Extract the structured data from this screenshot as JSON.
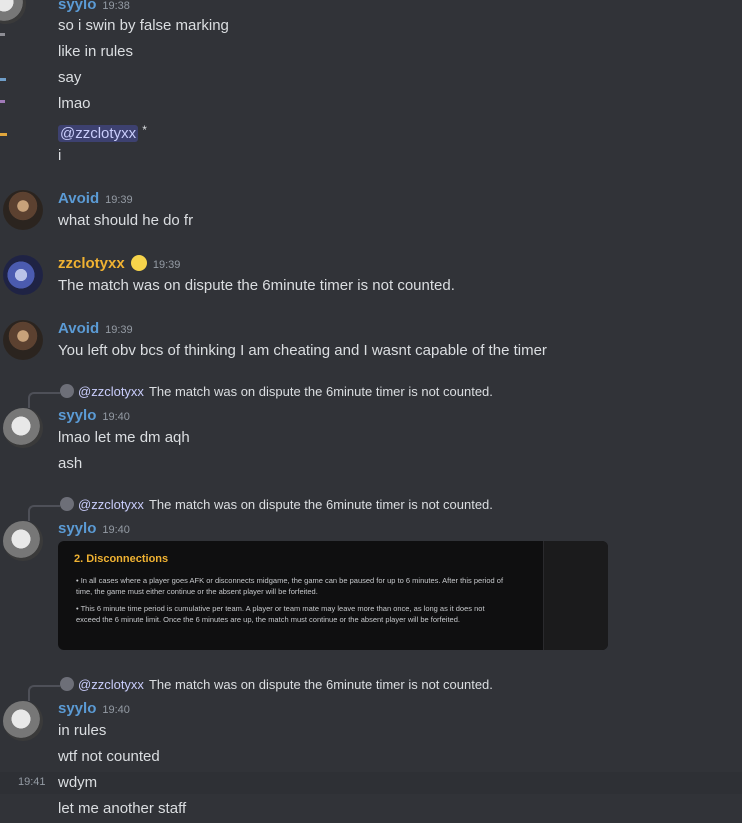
{
  "colors": {
    "background": "#313338",
    "username_blue": "#5b9bd5",
    "username_yellow": "#f0b232",
    "mention_bg": "#3c4270",
    "embed_bg": "#0f0f10",
    "embed_title": "#f0b232"
  },
  "messages": [
    {
      "username": "syylo",
      "time": "19:38",
      "lines": [
        "so i swin by false marking",
        "like in rules",
        "say",
        "lmao"
      ],
      "mention": "@zzclotyxx",
      "mention_suffix": "*",
      "last_line": "i"
    },
    {
      "username": "Avoid",
      "time": "19:39",
      "lines": [
        "what should he do fr"
      ]
    },
    {
      "username": "zzclotyxx",
      "badge_icon": "emoji-badge-icon",
      "time": "19:39",
      "lines": [
        "The match was on dispute the 6minute timer is not counted."
      ]
    },
    {
      "username": "Avoid",
      "time": "19:39",
      "lines": [
        "You left obv bcs of thinking I am cheating and I wasnt capable of the timer"
      ]
    },
    {
      "reply": {
        "who": "@zzclotyxx",
        "text": "The match was on dispute the 6minute timer is not counted."
      },
      "username": "syylo",
      "time": "19:40",
      "lines": [
        "lmao let me dm aqh",
        "ash"
      ]
    },
    {
      "reply": {
        "who": "@zzclotyxx",
        "text": "The match was on dispute the 6minute timer is not counted."
      },
      "username": "syylo",
      "time": "19:40",
      "embed": {
        "title": "2. Disconnections",
        "bullets": [
          "In all cases where a player goes AFK or disconnects midgame, the game can be paused for up to 6 minutes. After this period of time, the game must either continue or the absent player will be forfeited.",
          "This 6 minute time period is cumulative per team. A player or team mate may leave more than once, as long as it does not exceed the 6 minute limit. Once the 6 minutes are up, the match must continue or the absent player will be forfeited."
        ]
      }
    },
    {
      "reply": {
        "who": "@zzclotyxx",
        "text": "The match was on dispute the 6minute timer is not counted."
      },
      "username": "syylo",
      "time": "19:40",
      "lines": [
        "in rules",
        "wtf not counted"
      ],
      "hover_time": "19:41",
      "hover_line": "wdym",
      "after_line": "let me another staff"
    }
  ]
}
